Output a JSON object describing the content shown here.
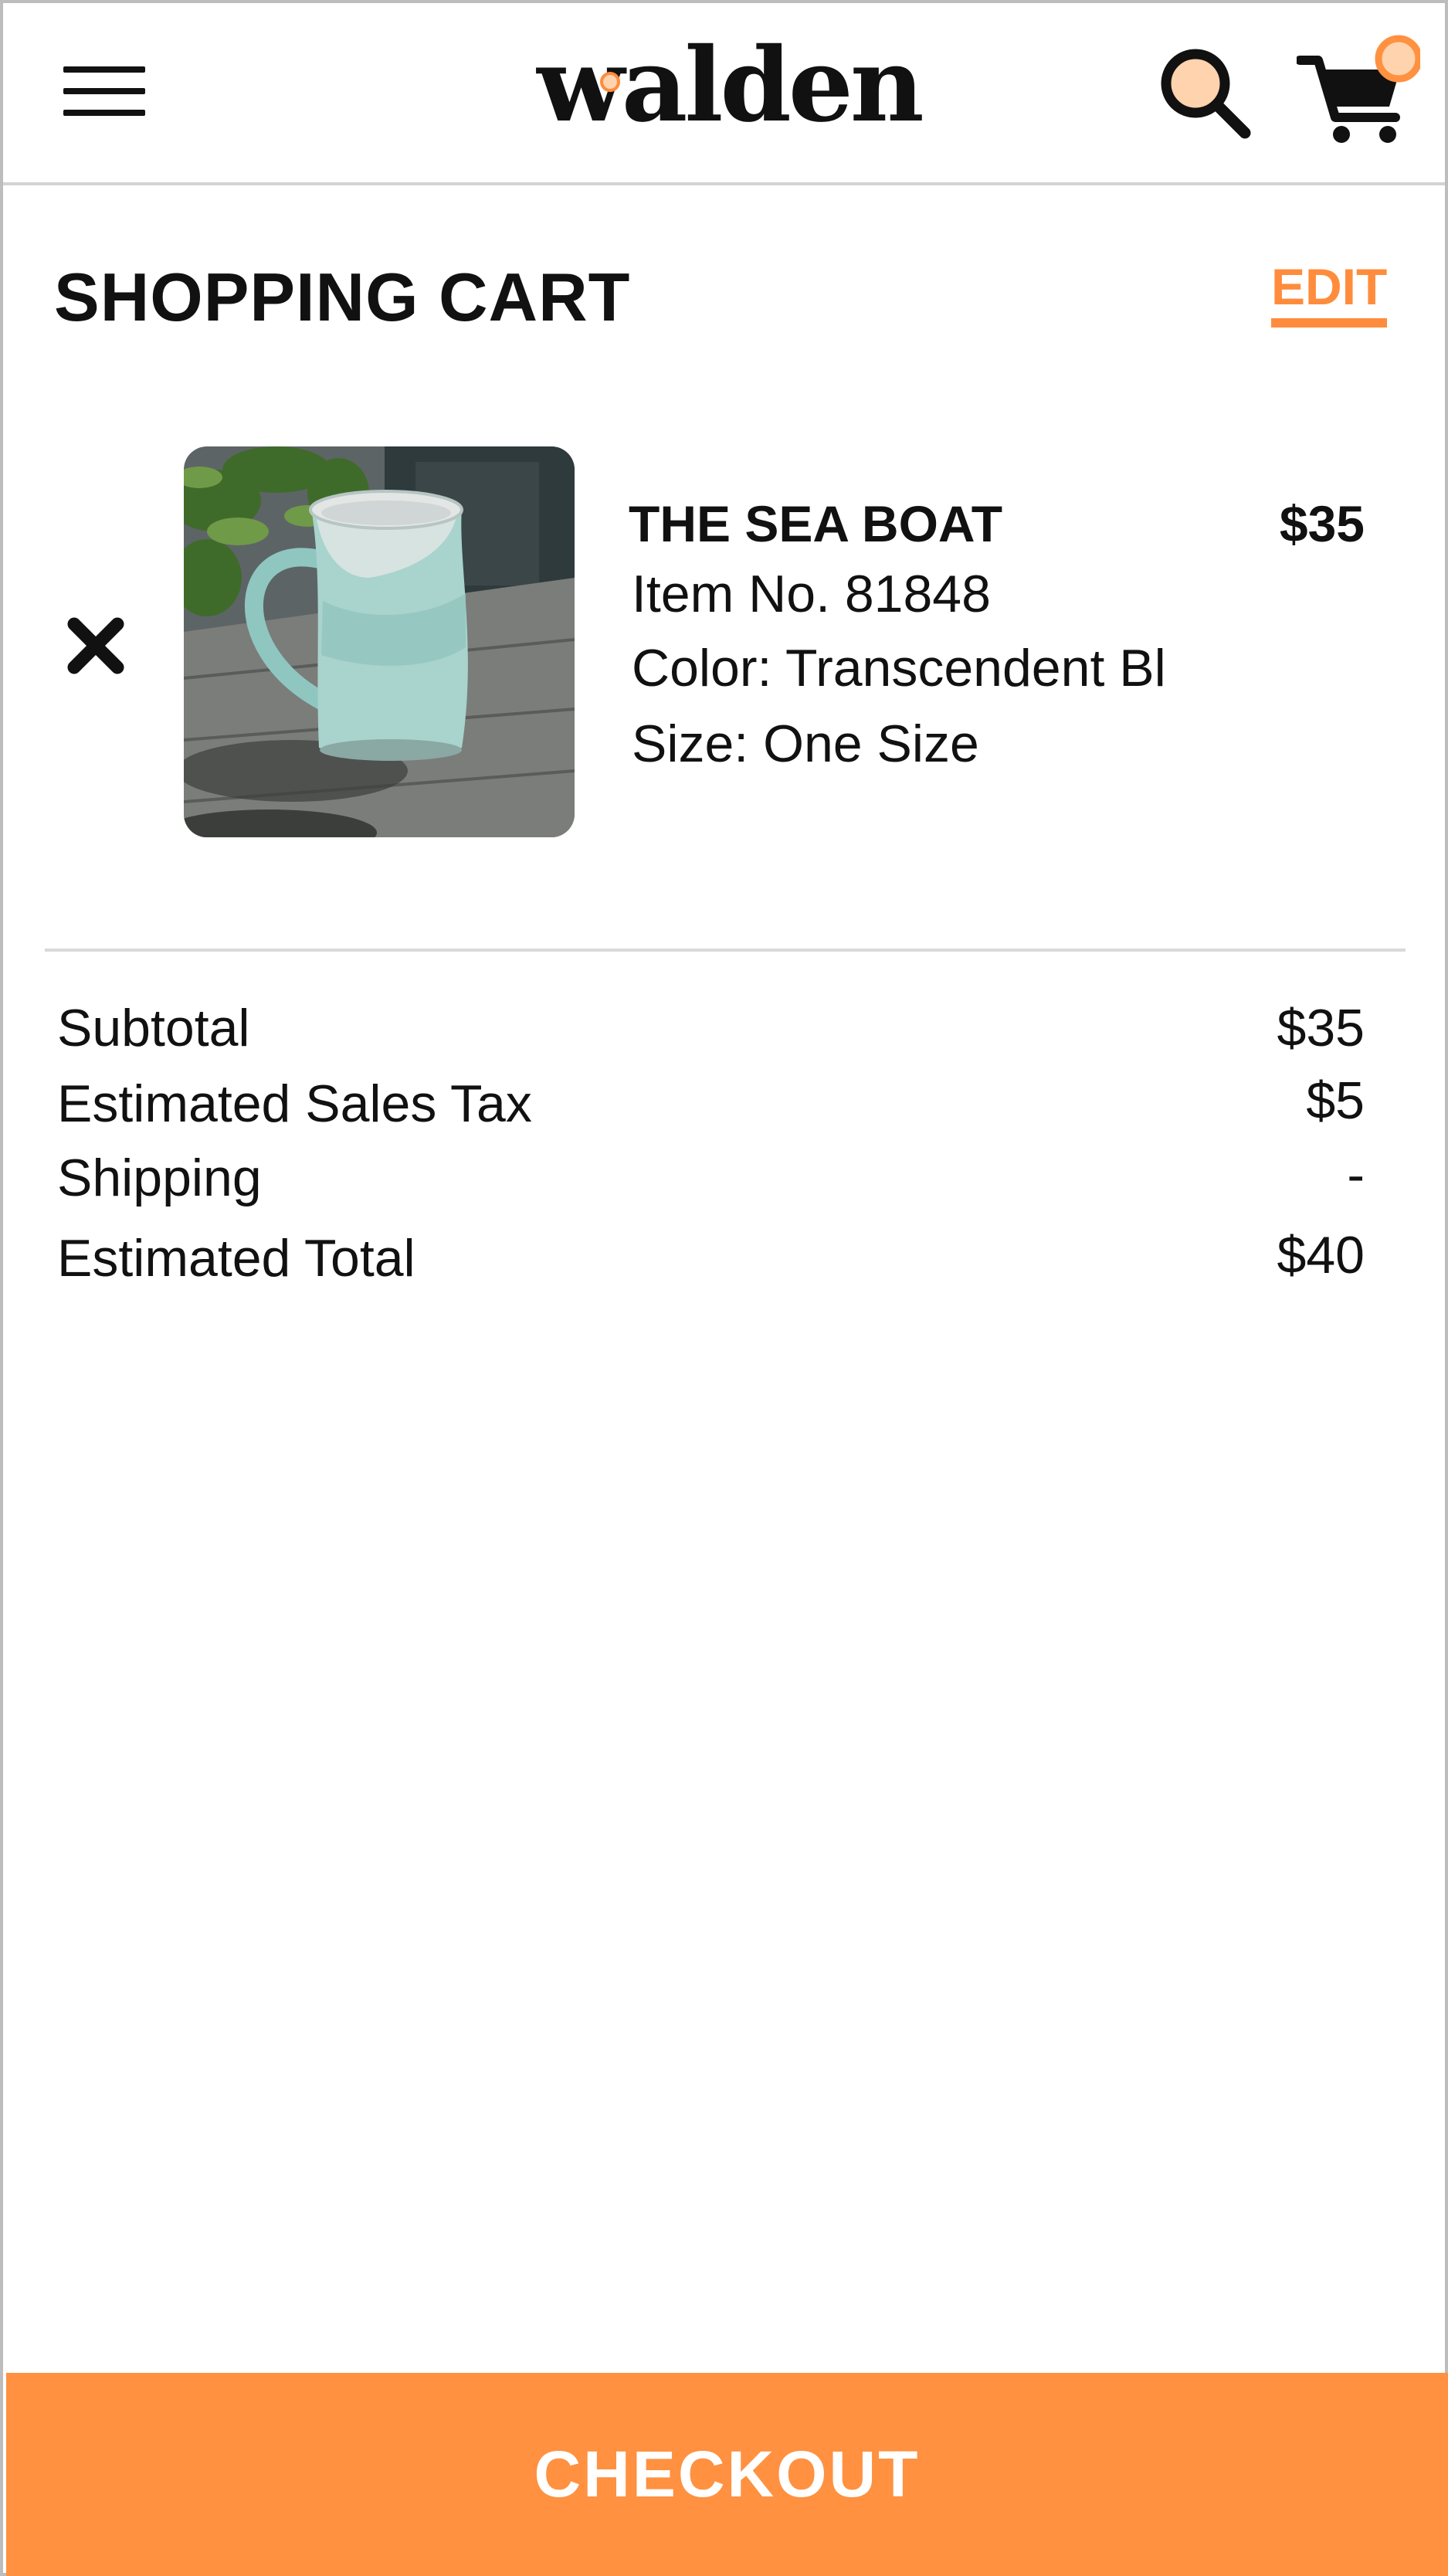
{
  "header": {
    "brand": "walden",
    "menu_icon": "hamburger-menu-icon",
    "search_icon": "search-icon",
    "cart_icon": "shopping-cart-icon",
    "accent_color": "#ff8c3c",
    "badge_color": "#ffd3ae"
  },
  "cart": {
    "title": "SHOPPING CART",
    "edit_label": "EDIT",
    "items": [
      {
        "name": "THE SEA BOAT",
        "price": "$35",
        "item_no": "Item No. 81848",
        "color": "Color: Transcendent Bl",
        "size": "Size: One Size",
        "remove_icon": "close-x-icon"
      }
    ]
  },
  "summary": {
    "subtotal_label": "Subtotal",
    "subtotal_value": "$35",
    "tax_label": "Estimated Sales Tax",
    "tax_value": "$5",
    "shipping_label": "Shipping",
    "shipping_value": "-",
    "total_label": "Estimated Total",
    "total_value": "$40"
  },
  "checkout": {
    "label": "CHECKOUT",
    "color": "#ff9140"
  }
}
